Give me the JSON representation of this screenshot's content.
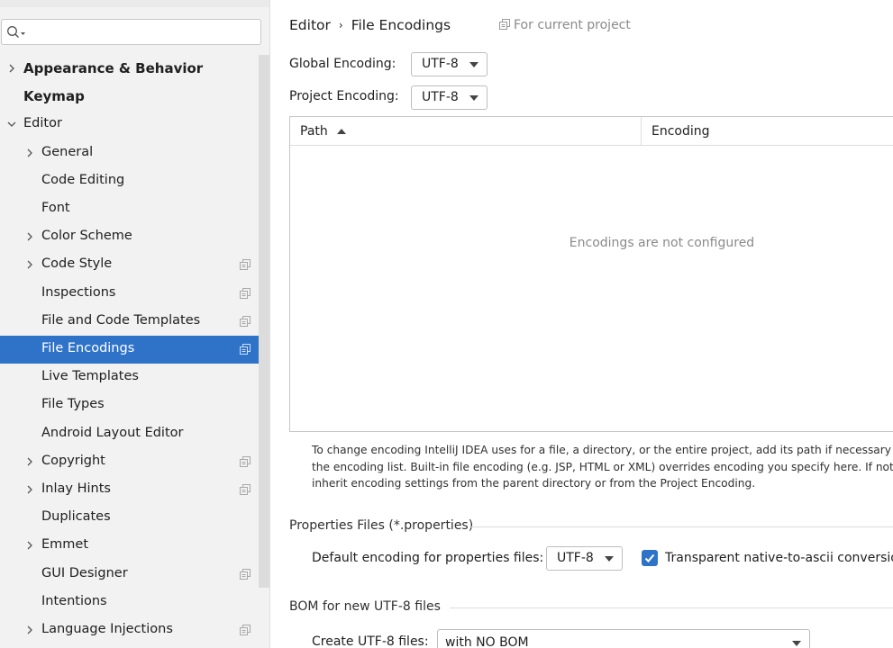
{
  "search": {
    "placeholder": "",
    "value": ""
  },
  "tree": [
    {
      "label": "Appearance & Behavior",
      "level": 0,
      "expandable": true,
      "expanded": false,
      "bold": true,
      "project": false,
      "selected": false
    },
    {
      "label": "Keymap",
      "level": 0,
      "expandable": false,
      "expanded": false,
      "bold": true,
      "project": false,
      "selected": false
    },
    {
      "label": "Editor",
      "level": 0,
      "expandable": true,
      "expanded": true,
      "bold": false,
      "project": false,
      "selected": false
    },
    {
      "label": "General",
      "level": 1,
      "expandable": true,
      "expanded": false,
      "bold": false,
      "project": false,
      "selected": false
    },
    {
      "label": "Code Editing",
      "level": 1,
      "expandable": false,
      "expanded": false,
      "bold": false,
      "project": false,
      "selected": false
    },
    {
      "label": "Font",
      "level": 1,
      "expandable": false,
      "expanded": false,
      "bold": false,
      "project": false,
      "selected": false
    },
    {
      "label": "Color Scheme",
      "level": 1,
      "expandable": true,
      "expanded": false,
      "bold": false,
      "project": false,
      "selected": false
    },
    {
      "label": "Code Style",
      "level": 1,
      "expandable": true,
      "expanded": false,
      "bold": false,
      "project": true,
      "selected": false
    },
    {
      "label": "Inspections",
      "level": 1,
      "expandable": false,
      "expanded": false,
      "bold": false,
      "project": true,
      "selected": false
    },
    {
      "label": "File and Code Templates",
      "level": 1,
      "expandable": false,
      "expanded": false,
      "bold": false,
      "project": true,
      "selected": false
    },
    {
      "label": "File Encodings",
      "level": 1,
      "expandable": false,
      "expanded": false,
      "bold": false,
      "project": true,
      "selected": true
    },
    {
      "label": "Live Templates",
      "level": 1,
      "expandable": false,
      "expanded": false,
      "bold": false,
      "project": false,
      "selected": false
    },
    {
      "label": "File Types",
      "level": 1,
      "expandable": false,
      "expanded": false,
      "bold": false,
      "project": false,
      "selected": false
    },
    {
      "label": "Android Layout Editor",
      "level": 1,
      "expandable": false,
      "expanded": false,
      "bold": false,
      "project": false,
      "selected": false
    },
    {
      "label": "Copyright",
      "level": 1,
      "expandable": true,
      "expanded": false,
      "bold": false,
      "project": true,
      "selected": false
    },
    {
      "label": "Inlay Hints",
      "level": 1,
      "expandable": true,
      "expanded": false,
      "bold": false,
      "project": true,
      "selected": false
    },
    {
      "label": "Duplicates",
      "level": 1,
      "expandable": false,
      "expanded": false,
      "bold": false,
      "project": false,
      "selected": false
    },
    {
      "label": "Emmet",
      "level": 1,
      "expandable": true,
      "expanded": false,
      "bold": false,
      "project": false,
      "selected": false
    },
    {
      "label": "GUI Designer",
      "level": 1,
      "expandable": false,
      "expanded": false,
      "bold": false,
      "project": true,
      "selected": false
    },
    {
      "label": "Intentions",
      "level": 1,
      "expandable": false,
      "expanded": false,
      "bold": false,
      "project": false,
      "selected": false
    },
    {
      "label": "Language Injections",
      "level": 1,
      "expandable": true,
      "expanded": false,
      "bold": false,
      "project": true,
      "selected": false
    }
  ],
  "breadcrumb": {
    "parent": "Editor",
    "separator": "›",
    "current": "File Encodings"
  },
  "for_project": "For current project",
  "global_encoding": {
    "label": "Global Encoding:",
    "value": "UTF-8"
  },
  "project_encoding": {
    "label": "Project Encoding:",
    "value": "UTF-8"
  },
  "table": {
    "columns": [
      "Path",
      "Encoding"
    ],
    "empty_text": "Encodings are not configured"
  },
  "help_lines": [
    "To change encoding IntelliJ IDEA uses for a file, a directory, or the entire project, add its path if necessary and",
    "the encoding list. Built-in file encoding (e.g. JSP, HTML or XML) overrides encoding you specify here. If not sp",
    "inherit encoding settings from the parent directory or from the Project Encoding."
  ],
  "properties_group": {
    "title": "Properties Files (*.properties)",
    "default_label": "Default encoding for properties files:",
    "default_value": "UTF-8",
    "checkbox_label": "Transparent native-to-ascii conversion",
    "checkbox_checked": true
  },
  "bom_group": {
    "title": "BOM for new UTF-8 files",
    "create_label": "Create UTF-8 files:",
    "create_value": "with NO BOM"
  },
  "colors": {
    "selection": "#2f73c9",
    "sidebar_bg": "#f2f2f2",
    "muted_text": "#8a8a8a"
  }
}
